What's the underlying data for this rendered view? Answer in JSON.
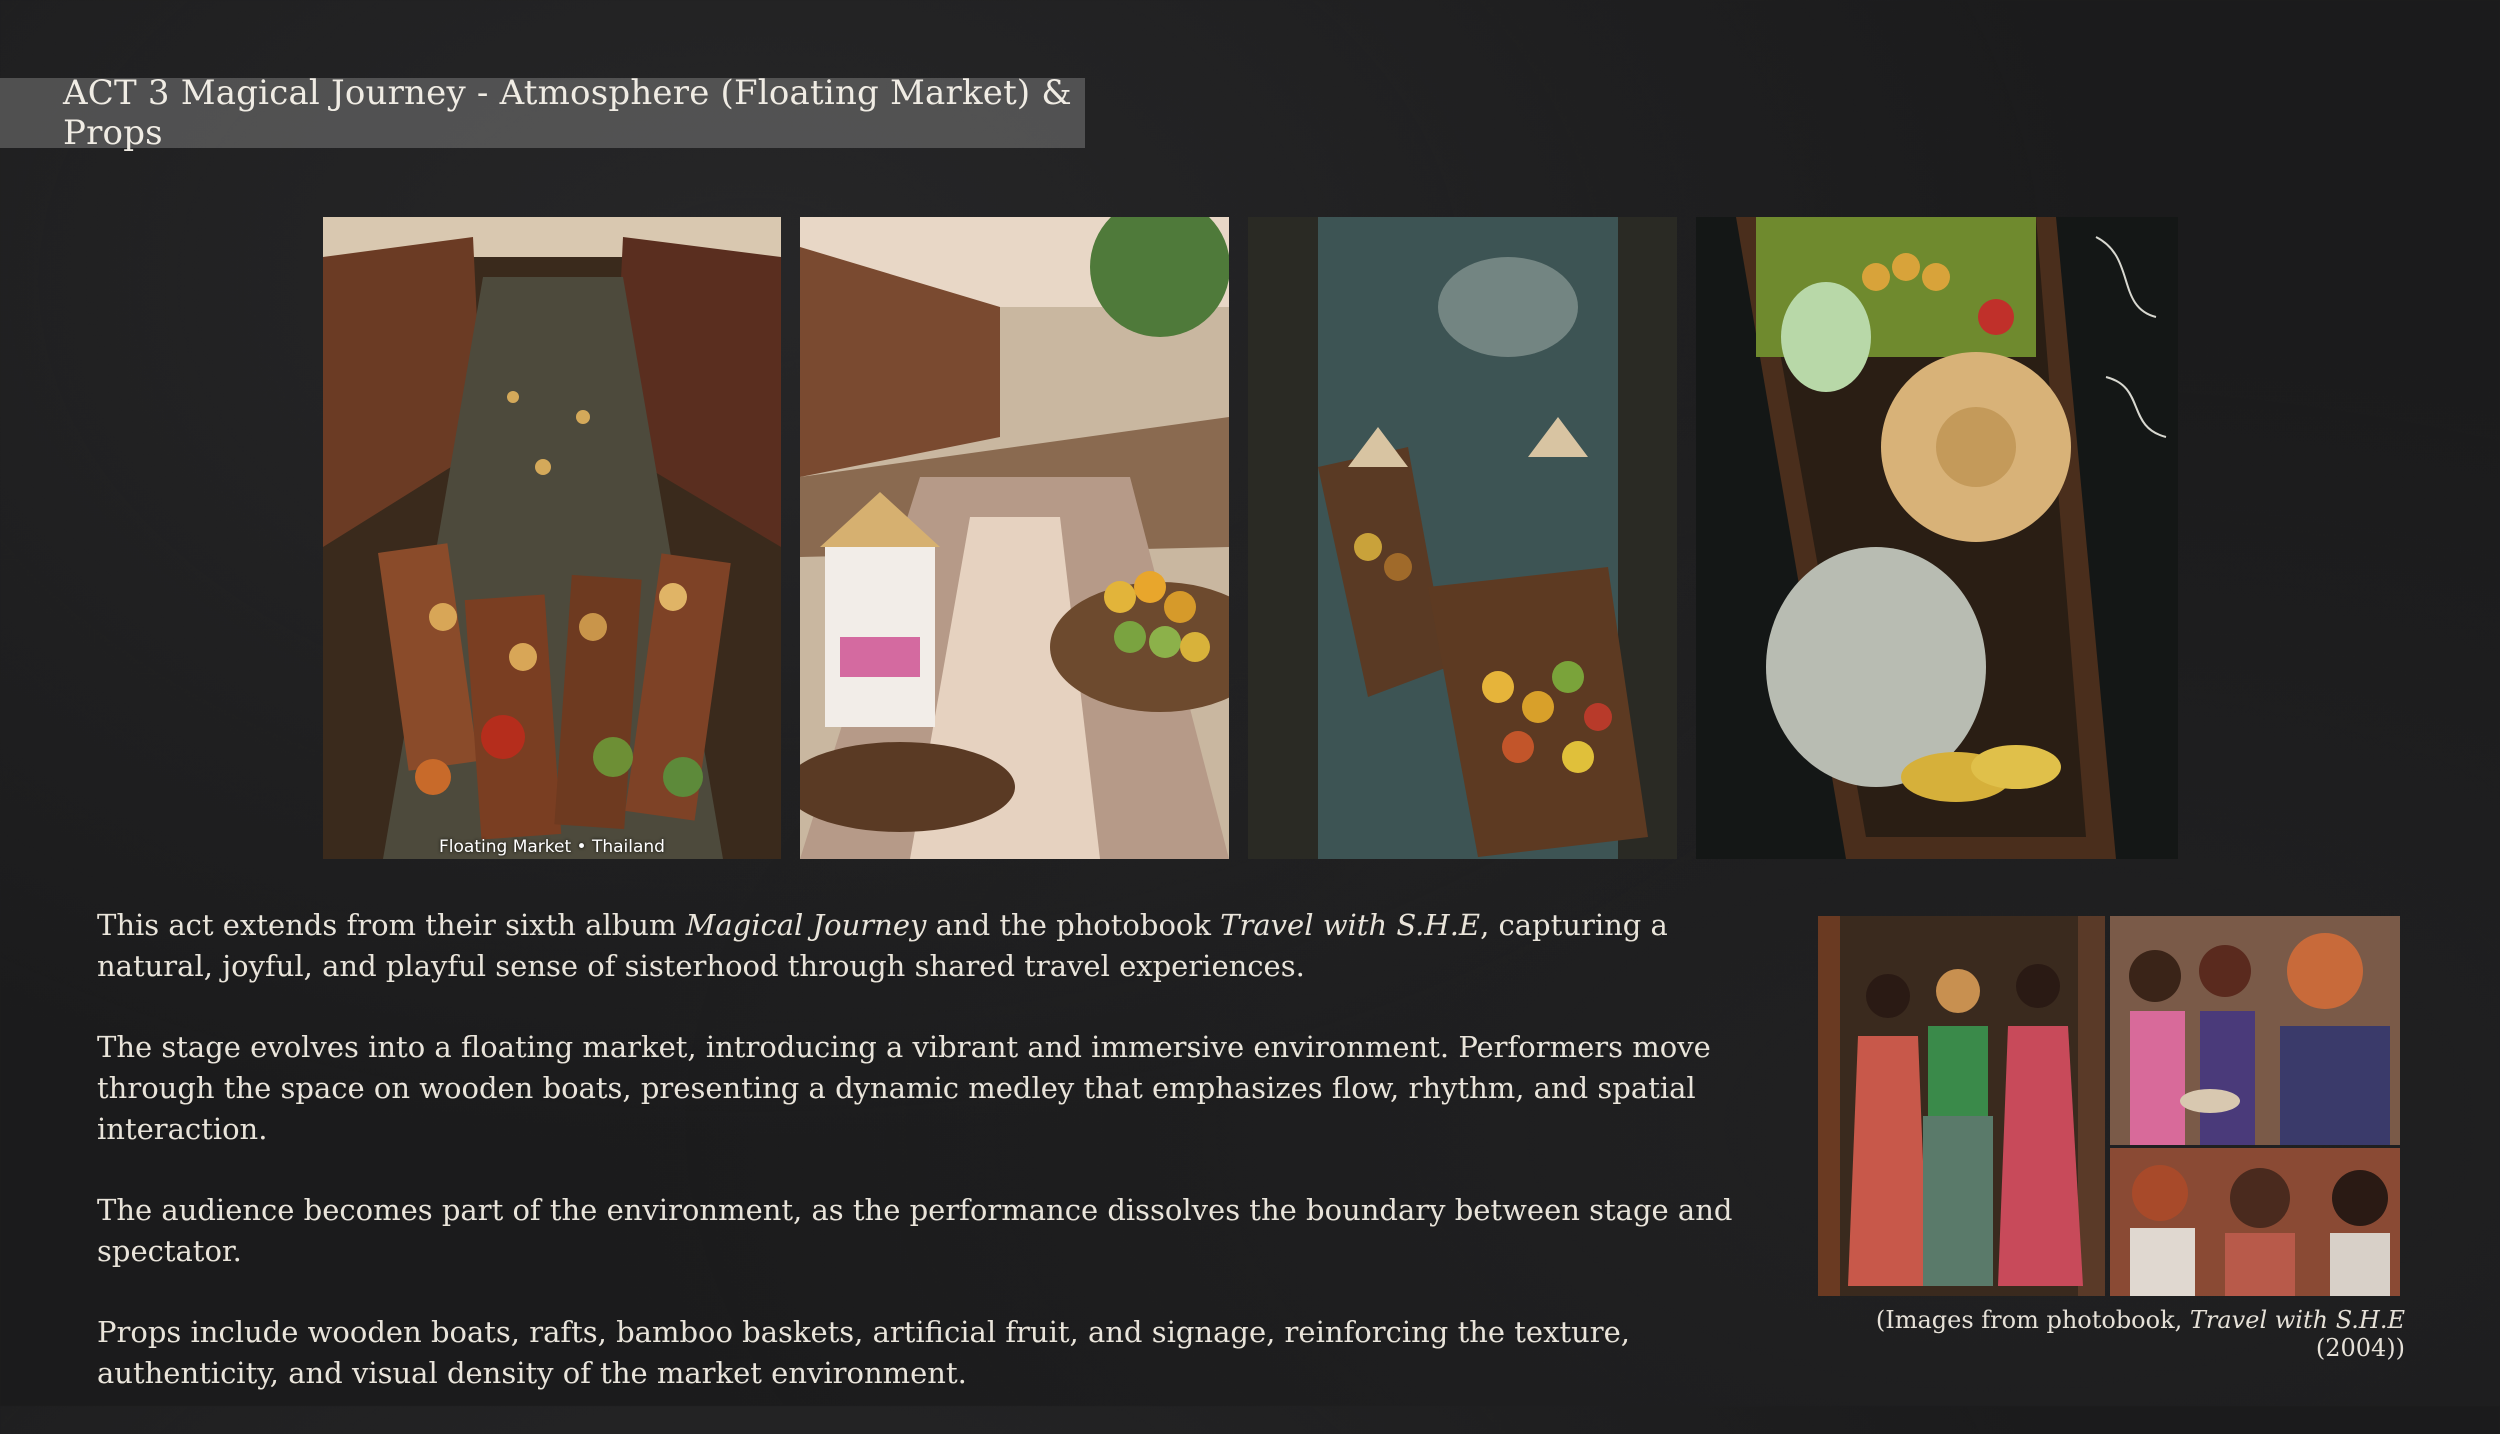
{
  "slide": {
    "title": "ACT 3 Magical Journey - Atmosphere (Floating Market) & Props"
  },
  "photos": {
    "photo1_caption": "Floating Market • Thailand"
  },
  "body": {
    "p1_a": "This act extends from their sixth album ",
    "p1_album": "Magical Journey",
    "p1_b": " and the photobook ",
    "p1_book": "Travel with S.H.E",
    "p1_c": ", capturing a natural, joyful, and playful sense of sisterhood through shared travel experiences.",
    "p2": "The stage evolves into a floating market, introducing a vibrant and immersive environment. Performers move through the space on wooden boats, presenting a dynamic medley that emphasizes flow, rhythm, and spatial interaction.",
    "p3": "The audience becomes part of the environment, as the performance dissolves the boundary between stage and spectator.",
    "p4": "Props include wooden boats, rafts, bamboo baskets, artificial fruit, and signage, reinforcing the texture, authenticity, and visual density of the market environment."
  },
  "photobook_caption": {
    "prefix": "(Images from photobook, ",
    "book": "Travel with S.H.E",
    "suffix": " (2004))"
  },
  "colors": {
    "background": "#1b1b1c",
    "title_bar": "#7a7a7a",
    "text": "#e9e4da"
  }
}
